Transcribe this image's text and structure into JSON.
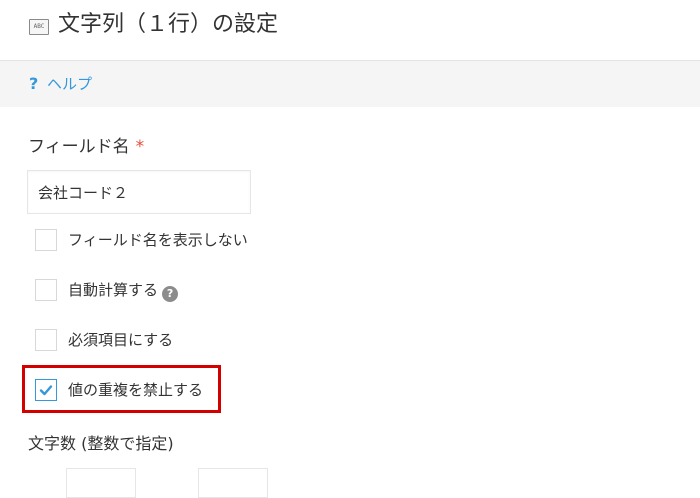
{
  "header": {
    "type_icon_text": "ABC",
    "title": "文字列（１行）の設定"
  },
  "help": {
    "icon": "?",
    "link": "ヘルプ"
  },
  "field_name": {
    "label": "フィールド名",
    "required_mark": "*",
    "value": "会社コード２"
  },
  "options": [
    {
      "label": "フィールド名を表示しない",
      "checked": false
    },
    {
      "label": "自動計算する",
      "checked": false,
      "help_icon": "?"
    },
    {
      "label": "必須項目にする",
      "checked": false
    },
    {
      "label": "値の重複を禁止する",
      "checked": true
    }
  ],
  "length": {
    "label": "文字数 (整数で指定)",
    "min_value": "",
    "max_value": ""
  },
  "colors": {
    "accent": "#3498db",
    "required": "#e74c3c",
    "highlight": "#d40000"
  }
}
